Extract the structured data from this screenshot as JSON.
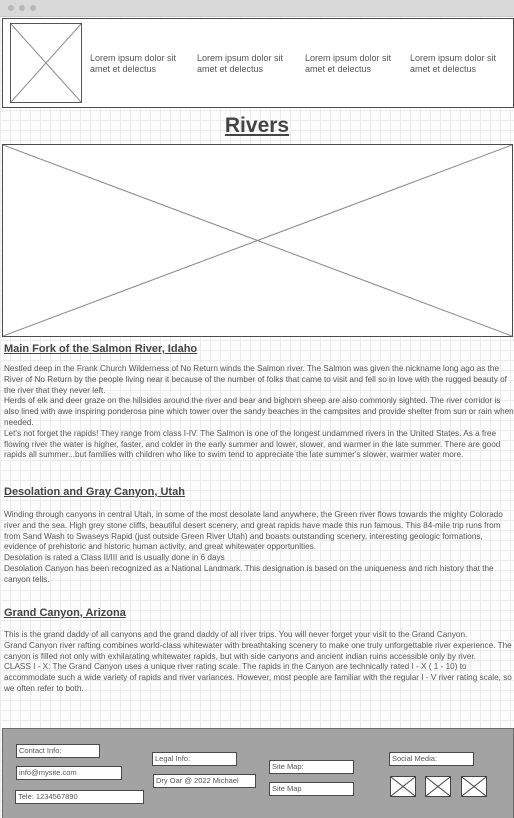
{
  "nav": {
    "items": [
      "Lorem ipsum dolor sit amet et delectus",
      "Lorem ipsum dolor sit amet et delectus",
      "Lorem ipsum dolor sit amet et delectus",
      "Lorem ipsum dolor sit amet et delectus"
    ]
  },
  "page": {
    "title": "Rivers"
  },
  "sections": [
    {
      "heading": "Main Fork of the Salmon River, Idaho",
      "paragraphs": [
        "Nestled deep in the Frank Church Wilderness of No Return winds the Salmon river. The Salmon was given the nickname long ago as the River of No Return by the people living near it because of the number of folks that came to visit and fell so in love with the rugged beauty of the river that they never left.",
        "Herds of elk and deer graze on the hillsides around the river and bear and bighorn sheep are also commonly sighted. The river corridor is also lined with awe inspiring ponderosa pine which tower over the sandy beaches in the campsites and provide shelter from sun or rain when needed.",
        "Let's not forget the rapids! They range from class I-IV. The Salmon is one of the longest undammed rivers in the United States. As a free flowing river the water is higher, faster, and colder in the early summer and lower, slower, and warmer in the late summer. There are good rapids all summer...but families with children who like to swim tend to appreciate the late summer's slower, warmer water more."
      ]
    },
    {
      "heading": "Desolation and Gray Canyon, Utah",
      "paragraphs": [
        "Winding through canyons in central Utah, in some of the most desolate land anywhere, the Green river flows towards the mighty Colorado river and the sea. High grey stone cliffs, beautiful desert scenery, and great rapids have made this run famous. This 84-mile trip runs from from Sand Wash to Swaseys Rapid (just outside Green River Utah) and boasts outstanding scenery, interesting geologic formations, evidence of prehistoric and historic human activity, and great whitewater opportunities.",
        "Desolation is rated a Class II/III and is usually done in 6 days",
        "Desolation Canyon has been recognized as a National Landmark. This designation is based on the uniqueness and rich history that the canyon tells."
      ]
    },
    {
      "heading": "Grand Canyon, Arizona",
      "paragraphs": [
        "This is the grand daddy of all canyons and the grand daddy of all river trips. You will never forget your visit to the Grand Canyon.",
        "Grand Canyon river rafting combines world-class whitewater with breathtaking scenery to make one truly unforgettable river experience. The canyon is filled not only with exhilarating whitewater rapids, but with side canyons and ancient indian ruins accessible only by river.",
        "CLASS I - X: The Grand Canyon uses a unique river rating scale. The rapids in the Canyon are technically rated I - X ( 1 - 10) to accommodate such a wide variety of rapids and river variances. However, most people are familiar with the regular I - V river rating scale, so we often refer to both."
      ]
    }
  ],
  "footer": {
    "contact_label": "Contact Info:",
    "email": "info@mysite.com",
    "phone": "Tele: 1234567890",
    "legal_label": "Legal Info:",
    "copyright": "Dry Oar @ 2022 Michael",
    "sitemap_label_1": "Site Map:",
    "sitemap_label_2": "Site Map",
    "social_label": "Social Media:"
  }
}
